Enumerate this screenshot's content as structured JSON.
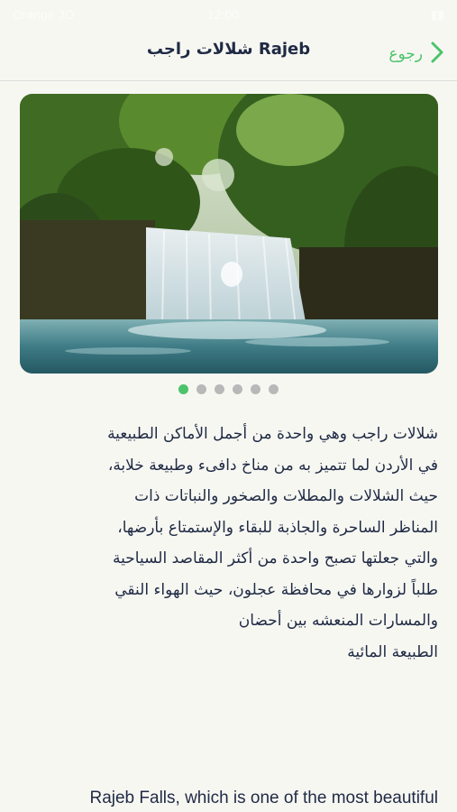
{
  "status_bar": {
    "left": "Orange JO",
    "center": "12:00",
    "right": ""
  },
  "nav": {
    "back_label": "رجوع",
    "title": "شلالات راجب Rajeb"
  },
  "gallery": {
    "image_count": 6,
    "active_index": 0
  },
  "description_ar": [
    "شلالات راجب وهي واحدة من أجمل الأماكن الطبيعية",
    "في الأردن لما تتميز به من مناخ دافىء وطبيعة خلابة،",
    "حيث الشلالات والمطلات والصخور والنباتات ذات",
    "المناظر الساحرة والجاذبة للبقاء  والإستمتاع بأرضها،",
    "والتي جعلتها تصبح واحدة من أكثر المقاصد السياحية",
    "طلباً لزوارها في محافظة عجلون، حيث الهواء النقي",
    "والمسارات المنعشه بين أحضان",
    "الطبيعة المائية"
  ],
  "description_en": "Rajeb Falls, which is one of the most beautiful",
  "colors": {
    "accent": "#4cc46a",
    "text": "#1f2a44",
    "background": "#f7f7f2"
  }
}
